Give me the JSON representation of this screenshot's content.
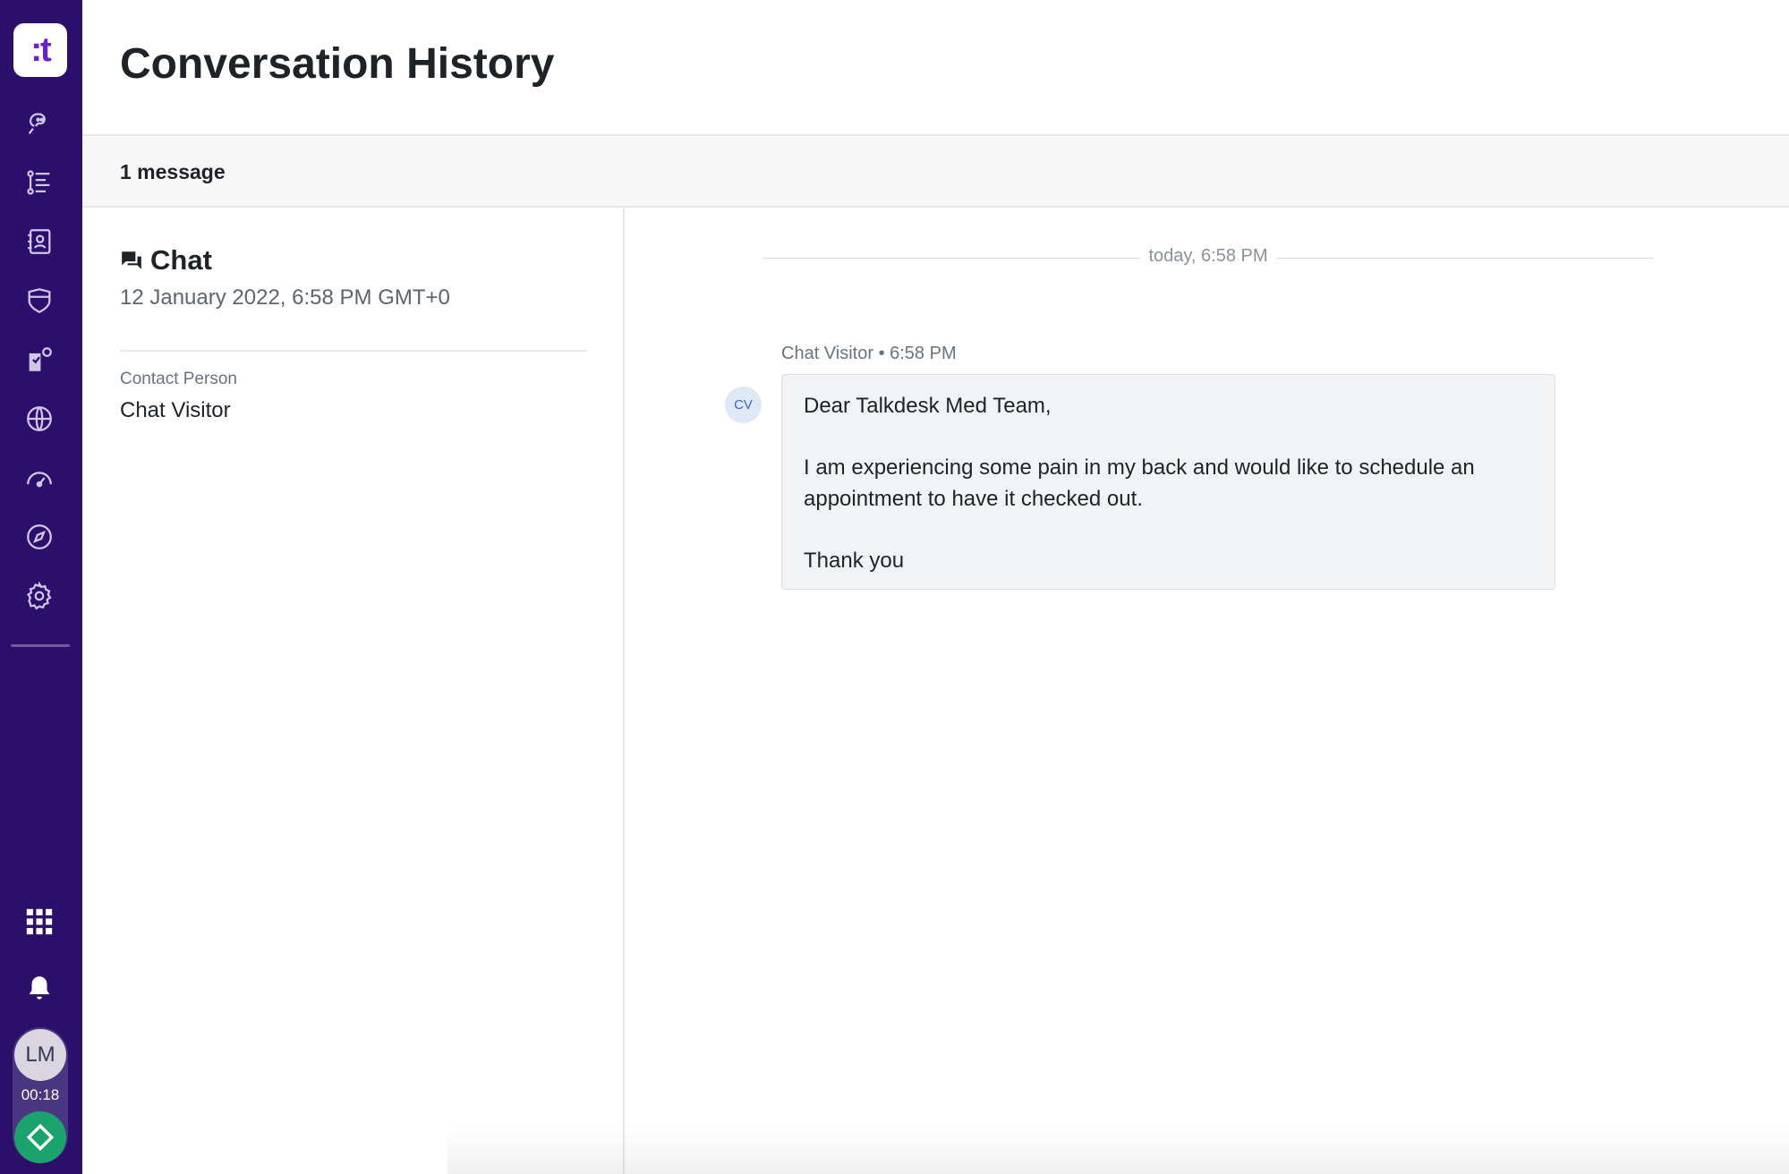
{
  "app": {
    "logo_text": ":t",
    "brand_color": "#2c0f6b",
    "accent_color": "#6a1fd6"
  },
  "nav": {
    "items": [
      {
        "icon": "conversations-icon"
      },
      {
        "icon": "list-icon"
      },
      {
        "icon": "contacts-icon"
      },
      {
        "icon": "shield-icon"
      },
      {
        "icon": "automation-icon"
      },
      {
        "icon": "globe-icon"
      },
      {
        "icon": "dashboard-gauge-icon"
      },
      {
        "icon": "compass-icon"
      },
      {
        "icon": "settings-icon"
      }
    ],
    "bottom": [
      {
        "icon": "apps-grid-icon"
      },
      {
        "icon": "bell-icon"
      }
    ],
    "user": {
      "initials": "LM",
      "timer": "00:18",
      "status_color": "#1aa36d"
    }
  },
  "header": {
    "title": "Conversation History"
  },
  "subbar": {
    "count": "1 message"
  },
  "details": {
    "channel_icon": "chat-bubbles-icon",
    "channel": "Chat",
    "date": "12 January 2022, 6:58 PM GMT+0",
    "contact_label": "Contact Person",
    "contact_value": "Chat Visitor"
  },
  "conversation": {
    "separator": "today, 6:58 PM",
    "messages": [
      {
        "meta": "Chat Visitor • 6:58 PM",
        "avatar": "CV",
        "lines": [
          "Dear Talkdesk Med Team,",
          "I am experiencing some pain in my back and would like to schedule an",
          "appointment to have it checked out.",
          "Thank you"
        ]
      }
    ]
  }
}
